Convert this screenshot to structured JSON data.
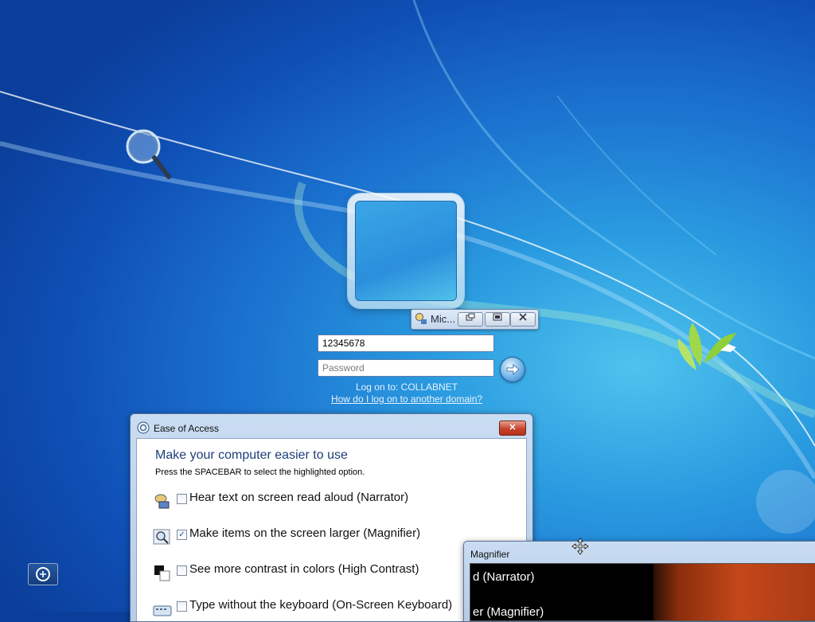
{
  "login": {
    "username_value": "12345678",
    "password_placeholder": "Password",
    "logon_to": "Log on to: COLLABNET",
    "other_domain_link": "How do I log on to another domain?"
  },
  "mini_magnifier": {
    "title": "Mic..."
  },
  "ease_of_access": {
    "window_title": "Ease of Access",
    "heading": "Make your computer easier to use",
    "instruction": "Press the SPACEBAR to select the highlighted option.",
    "close_label": "✕",
    "options": [
      {
        "label": "Hear text on screen read aloud (Narrator)",
        "checked": false,
        "icon": "narrator-icon"
      },
      {
        "label": "Make items on the screen larger (Magnifier)",
        "checked": true,
        "icon": "magnifier-icon"
      },
      {
        "label": "See more contrast in colors (High Contrast)",
        "checked": false,
        "icon": "high-contrast-icon"
      },
      {
        "label": "Type without the keyboard (On-Screen Keyboard)",
        "checked": false,
        "icon": "keyboard-icon"
      }
    ]
  },
  "magnifier_window": {
    "title": "Magnifier",
    "zoom_line1": "d (Narrator)",
    "zoom_line2": "er (Magnifier)"
  },
  "colors": {
    "desktop_accent": "#1b72cf",
    "heading_blue": "#1e3f78",
    "close_red": "#c7432d"
  }
}
